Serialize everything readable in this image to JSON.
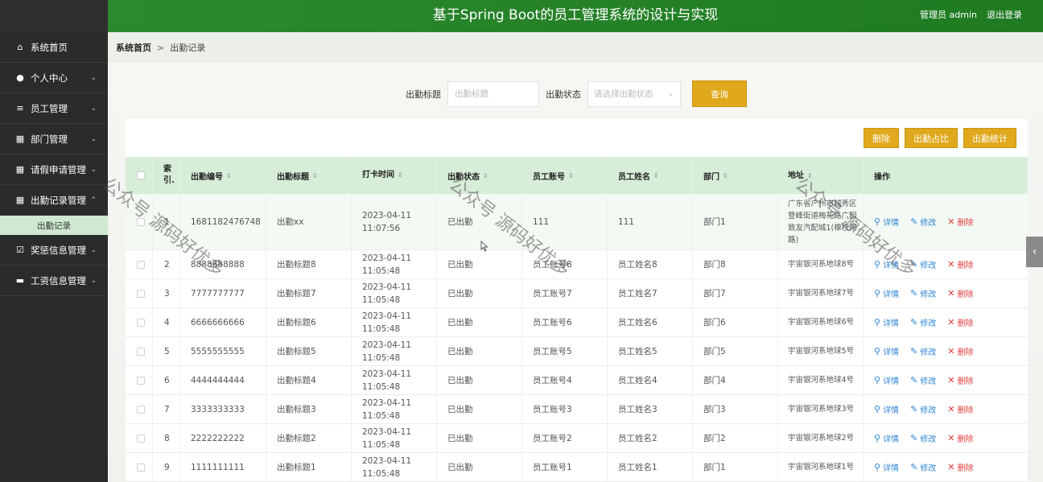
{
  "header": {
    "title": "基于Spring Boot的员工管理系统的设计与实现",
    "user": "管理员 admin",
    "logout": "退出登录"
  },
  "sidebar": {
    "items": [
      {
        "label": "系统首页",
        "icon": "home-icon",
        "glyph": "⌂",
        "chevron": ""
      },
      {
        "label": "个人中心",
        "icon": "user-icon",
        "glyph": "●",
        "chevron": "⌄"
      },
      {
        "label": "员工管理",
        "icon": "list-icon",
        "glyph": "≡",
        "chevron": "⌄"
      },
      {
        "label": "部门管理",
        "icon": "grid-icon",
        "glyph": "▦",
        "chevron": "⌄"
      },
      {
        "label": "请假申请管理",
        "icon": "table-icon",
        "glyph": "▦",
        "chevron": "⌄"
      },
      {
        "label": "出勤记录管理",
        "icon": "grid-icon",
        "glyph": "▦",
        "chevron": "⌃"
      },
      {
        "label": "奖惩信息管理",
        "icon": "checkbox-icon",
        "glyph": "☑",
        "chevron": "⌄"
      },
      {
        "label": "工资信息管理",
        "icon": "card-icon",
        "glyph": "▬",
        "chevron": "⌄"
      }
    ],
    "sub_item": "出勤记录"
  },
  "breadcrumb": {
    "home": "系统首页",
    "sep": ">",
    "current": "出勤记录"
  },
  "search": {
    "title_label": "出勤标题",
    "title_placeholder": "出勤标题",
    "status_label": "出勤状态",
    "status_placeholder": "请选择出勤状态",
    "query_button": "查询"
  },
  "actions": {
    "delete": "删除",
    "ratio": "出勤占比",
    "stats": "出勤统计"
  },
  "table": {
    "headers": {
      "index": "索引.",
      "no": "出勤编号",
      "title": "出勤标题",
      "time": "打卡时间",
      "status": "出勤状态",
      "account": "员工账号",
      "name": "员工姓名",
      "dept": "部门",
      "addr": "地址",
      "ops": "操作"
    },
    "rows": [
      {
        "idx": "1",
        "no": "1681182476748",
        "title": "出勤xx",
        "time": "2023-04-11 11:07:56",
        "status": "已出勤",
        "account": "111",
        "name": "111",
        "dept": "部门1",
        "addr": "广东省广州市越秀区登峰街道梅花路广园致友汽配城1(橡枝岗路)"
      },
      {
        "idx": "2",
        "no": "8888888888",
        "title": "出勤标题8",
        "time": "2023-04-11 11:05:48",
        "status": "已出勤",
        "account": "员工账号8",
        "name": "员工姓名8",
        "dept": "部门8",
        "addr": "宇宙银河系地球8号"
      },
      {
        "idx": "3",
        "no": "7777777777",
        "title": "出勤标题7",
        "time": "2023-04-11 11:05:48",
        "status": "已出勤",
        "account": "员工账号7",
        "name": "员工姓名7",
        "dept": "部门7",
        "addr": "宇宙银河系地球7号"
      },
      {
        "idx": "4",
        "no": "6666666666",
        "title": "出勤标题6",
        "time": "2023-04-11 11:05:48",
        "status": "已出勤",
        "account": "员工账号6",
        "name": "员工姓名6",
        "dept": "部门6",
        "addr": "宇宙银河系地球6号"
      },
      {
        "idx": "5",
        "no": "5555555555",
        "title": "出勤标题5",
        "time": "2023-04-11 11:05:48",
        "status": "已出勤",
        "account": "员工账号5",
        "name": "员工姓名5",
        "dept": "部门5",
        "addr": "宇宙银河系地球5号"
      },
      {
        "idx": "6",
        "no": "4444444444",
        "title": "出勤标题4",
        "time": "2023-04-11 11:05:48",
        "status": "已出勤",
        "account": "员工账号4",
        "name": "员工姓名4",
        "dept": "部门4",
        "addr": "宇宙银河系地球4号"
      },
      {
        "idx": "7",
        "no": "3333333333",
        "title": "出勤标题3",
        "time": "2023-04-11 11:05:48",
        "status": "已出勤",
        "account": "员工账号3",
        "name": "员工姓名3",
        "dept": "部门3",
        "addr": "宇宙银河系地球3号"
      },
      {
        "idx": "8",
        "no": "2222222222",
        "title": "出勤标题2",
        "time": "2023-04-11 11:05:48",
        "status": "已出勤",
        "account": "员工账号2",
        "name": "员工姓名2",
        "dept": "部门2",
        "addr": "宇宙银河系地球2号"
      },
      {
        "idx": "9",
        "no": "1111111111",
        "title": "出勤标题1",
        "time": "2023-04-11 11:05:48",
        "status": "已出勤",
        "account": "员工账号1",
        "name": "员工姓名1",
        "dept": "部门1",
        "addr": "宇宙银河系地球1号"
      }
    ],
    "op_labels": {
      "detail": "详情",
      "edit": "修改",
      "delete": "删除"
    }
  },
  "watermark": "公众号 源码好优多",
  "colors": {
    "header_green": "#2b8a2e",
    "sidebar_bg": "#2b2b2b",
    "button_yellow": "#e0a81c",
    "table_header": "#d7edd7",
    "link_blue": "#2f86d6",
    "delete_red": "#e03c3c"
  }
}
